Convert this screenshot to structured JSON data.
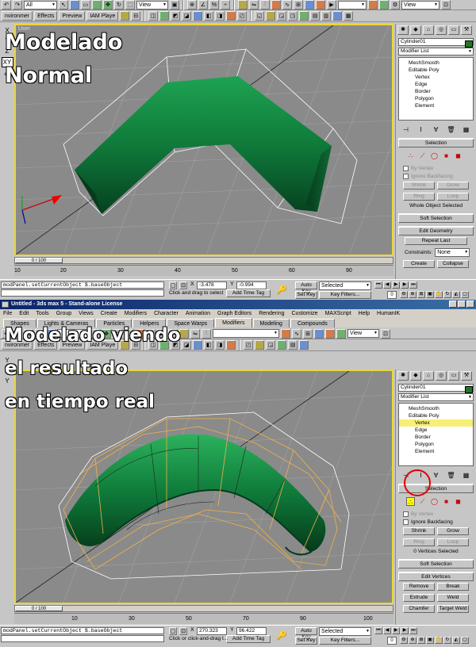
{
  "top": {
    "toolbar": {
      "selection_filter": "All",
      "ref_coord": "View",
      "view_right": "View"
    },
    "tabs_row": [
      "nvironmer",
      "Effects",
      "Preview",
      "IAM Playe"
    ],
    "left_axes": [
      "X",
      "Y",
      "Z",
      "XY"
    ],
    "viewport_label": "User",
    "overlay_line1": "Modelado",
    "overlay_line2": "Normal",
    "timeslider": "0 / 100",
    "ticks": [
      "10",
      "20",
      "30",
      "40",
      "50",
      "60",
      "70",
      "80",
      "90",
      "100"
    ],
    "ticks_tail": "10",
    "ticks_right": "90",
    "status": {
      "maxscript": "modPanel.setCurrentObject $.baseObject",
      "prompt": "Click and drag to select",
      "add_time_tag": "Add Time Tag",
      "x_label": "X",
      "x_value": "-3.478",
      "y_label": "Y",
      "y_value": "-0.994",
      "auto_key": "Auto Key",
      "set_key": "Set Key",
      "selected": "Selected",
      "key_filters": "Key Filters...",
      "frame": "0"
    },
    "cmd": {
      "object_name": "Cylinder01",
      "modifier_list": "Modifier List",
      "stack": [
        "MeshSmooth",
        "Editable Poly",
        "Vertex",
        "Edge",
        "Border",
        "Polygon",
        "Element"
      ],
      "selection_title": "Selection",
      "by_vertex": "By Vertex",
      "ignore_backfacing": "Ignore Backfacing",
      "shrink": "Shrink",
      "grow": "Grow",
      "ring": "Ring",
      "loop": "Loop",
      "whole_object": "Whole Object Selected",
      "soft_selection": "Soft Selection",
      "edit_geometry": "Edit Geometry",
      "repeat_last": "Repeat Last",
      "constraints": "Constraints:",
      "constraints_value": "None",
      "create": "Create",
      "collapse": "Collapse"
    }
  },
  "bottom": {
    "title": "Untitled - 3ds max 5 - Stand-alone License",
    "menu": [
      "File",
      "Edit",
      "Tools",
      "Group",
      "Views",
      "Create",
      "Modifiers",
      "Character",
      "Animation",
      "Graph Editors",
      "Rendering",
      "Customize",
      "MAXScript",
      "Help",
      "HumanIK"
    ],
    "tabs": [
      "Shapes",
      "Lights & Cameras",
      "Particles",
      "Helpers",
      "Space Warps",
      "Modifiers",
      "Modeling",
      "Compounds"
    ],
    "active_tab": "Modifiers",
    "tabs_row": [
      "nvironmer",
      "Effects",
      "Preview",
      "IAM Playe"
    ],
    "toolbar": {
      "ref_coord": "View"
    },
    "left_axes": [
      "Y",
      "Z",
      "Y"
    ],
    "overlay_line1": "Modelado viendo",
    "overlay_line2": "el resultado",
    "overlay_line3": "en tiempo real",
    "timeslider": "0 / 100",
    "ticks": [
      "10",
      "20",
      "30",
      "40",
      "50",
      "60",
      "70",
      "80",
      "90",
      "100"
    ],
    "status": {
      "maxscript": "modPanel.setCurrentObject $.baseObject",
      "prompt": "Click or click-and-drag t...",
      "add_time_tag": "Add Time Tag",
      "x_label": "X",
      "x_value": "270.323",
      "y_label": "Y",
      "y_value": "96.422",
      "auto_key": "Auto Key",
      "set_key": "Set Key",
      "selected": "Selected",
      "key_filters": "Key Filters...",
      "frame": "0"
    },
    "cmd": {
      "object_name": "Cylinder01",
      "modifier_list": "Modifier List",
      "stack": [
        "MeshSmooth",
        "Editable Poly",
        "Vertex",
        "Edge",
        "Border",
        "Polygon",
        "Element"
      ],
      "selected_stack_item": "Vertex",
      "selection_title": "Selection",
      "by_vertex": "By Vertex",
      "ignore_backfacing": "Ignore Backfacing",
      "shrink": "Shrink",
      "grow": "Grow",
      "ring": "Ring",
      "loop": "Loop",
      "vertices_selected": "0 Vertices Selected",
      "soft_selection": "Soft Selection",
      "edit_vertices": "Edit Vertices",
      "remove": "Remove",
      "break": "Break",
      "extrude": "Extrude",
      "weld": "Weld",
      "chamfer": "Chamfer",
      "target_weld": "Target Weld"
    }
  },
  "colors": {
    "viewport_border": "#e9d73a",
    "mesh_green": "#0f7a3a",
    "cage_orange": "#e8a13a",
    "highlight": "#f7ef77",
    "title_blue": "#0a246a"
  }
}
